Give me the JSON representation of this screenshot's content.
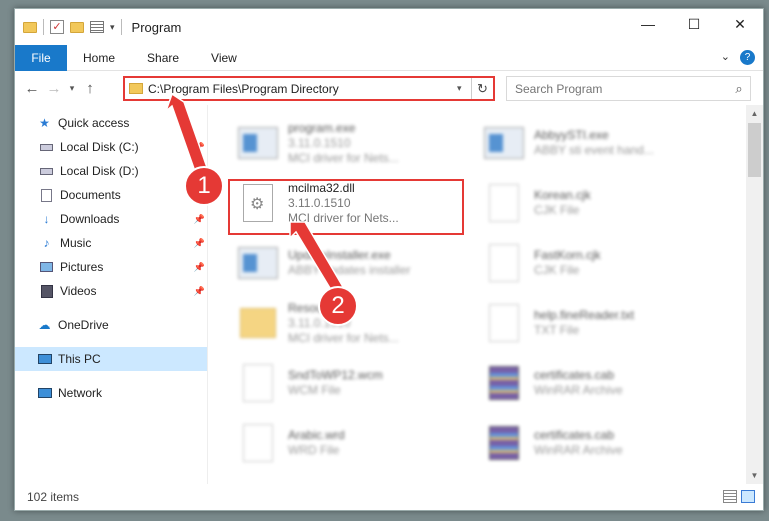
{
  "window": {
    "title": "Program",
    "controls": {
      "minimize": "—",
      "maximize": "☐",
      "close": "✕"
    }
  },
  "ribbon": {
    "file_label": "File",
    "tabs": [
      "Home",
      "Share",
      "View"
    ]
  },
  "nav": {
    "address": "C:\\Program Files\\Program Directory",
    "search_placeholder": "Search Program"
  },
  "sidebar": {
    "items": [
      {
        "label": "Quick access",
        "icon": "star-icon",
        "pinned": false
      },
      {
        "label": "Local Disk (C:)",
        "icon": "drive-icon",
        "pinned": true
      },
      {
        "label": "Local Disk (D:)",
        "icon": "drive-icon",
        "pinned": false
      },
      {
        "label": "Documents",
        "icon": "documents-icon",
        "pinned": true
      },
      {
        "label": "Downloads",
        "icon": "download-icon",
        "pinned": true
      },
      {
        "label": "Music",
        "icon": "music-icon",
        "pinned": true
      },
      {
        "label": "Pictures",
        "icon": "pictures-icon",
        "pinned": true
      },
      {
        "label": "Videos",
        "icon": "videos-icon",
        "pinned": true
      },
      {
        "label": "OneDrive",
        "icon": "cloud-icon",
        "pinned": false
      },
      {
        "label": "This PC",
        "icon": "computer-icon",
        "pinned": false,
        "selected": true
      },
      {
        "label": "Network",
        "icon": "network-icon",
        "pinned": false
      }
    ]
  },
  "files": [
    {
      "name": "program.exe",
      "line2": "3.11.0.1510",
      "line3": "MCI driver for Nets...",
      "type": "exe"
    },
    {
      "name": "AbbyySTI.exe",
      "line2": "ABBY sti event hand...",
      "line3": "",
      "type": "exe"
    },
    {
      "name": "mcilma32.dll",
      "line2": "3.11.0.1510",
      "line3": "MCI driver for Nets...",
      "type": "dll",
      "highlighted": true
    },
    {
      "name": "Korean.cjk",
      "line2": "CJK File",
      "line3": "",
      "type": "doc"
    },
    {
      "name": "UpdateInstaller.exe",
      "line2": "ABBY updates installer",
      "line3": "",
      "type": "exe"
    },
    {
      "name": "FastKorn.cjk",
      "line2": "CJK File",
      "line3": "",
      "type": "doc"
    },
    {
      "name": "Resources",
      "line2": "3.11.0.1510",
      "line3": "MCI driver for Nets...",
      "type": "folder"
    },
    {
      "name": "help.fineReader.txt",
      "line2": "TXT File",
      "line3": "",
      "type": "doc"
    },
    {
      "name": "SndToWP12.wcm",
      "line2": "WCM File",
      "line3": "",
      "type": "doc"
    },
    {
      "name": "certificates.cab",
      "line2": "WinRAR Archive",
      "line3": "",
      "type": "rar"
    },
    {
      "name": "Arabic.wrd",
      "line2": "WRD File",
      "line3": "",
      "type": "doc"
    },
    {
      "name": "certificates.cab",
      "line2": "WinRAR Archive",
      "line3": "",
      "type": "rar"
    }
  ],
  "status": {
    "item_count": "102 items"
  },
  "callouts": {
    "one": "1",
    "two": "2"
  },
  "colors": {
    "accent": "#1979ca",
    "highlight": "#e53935",
    "selection": "#cce8ff"
  }
}
